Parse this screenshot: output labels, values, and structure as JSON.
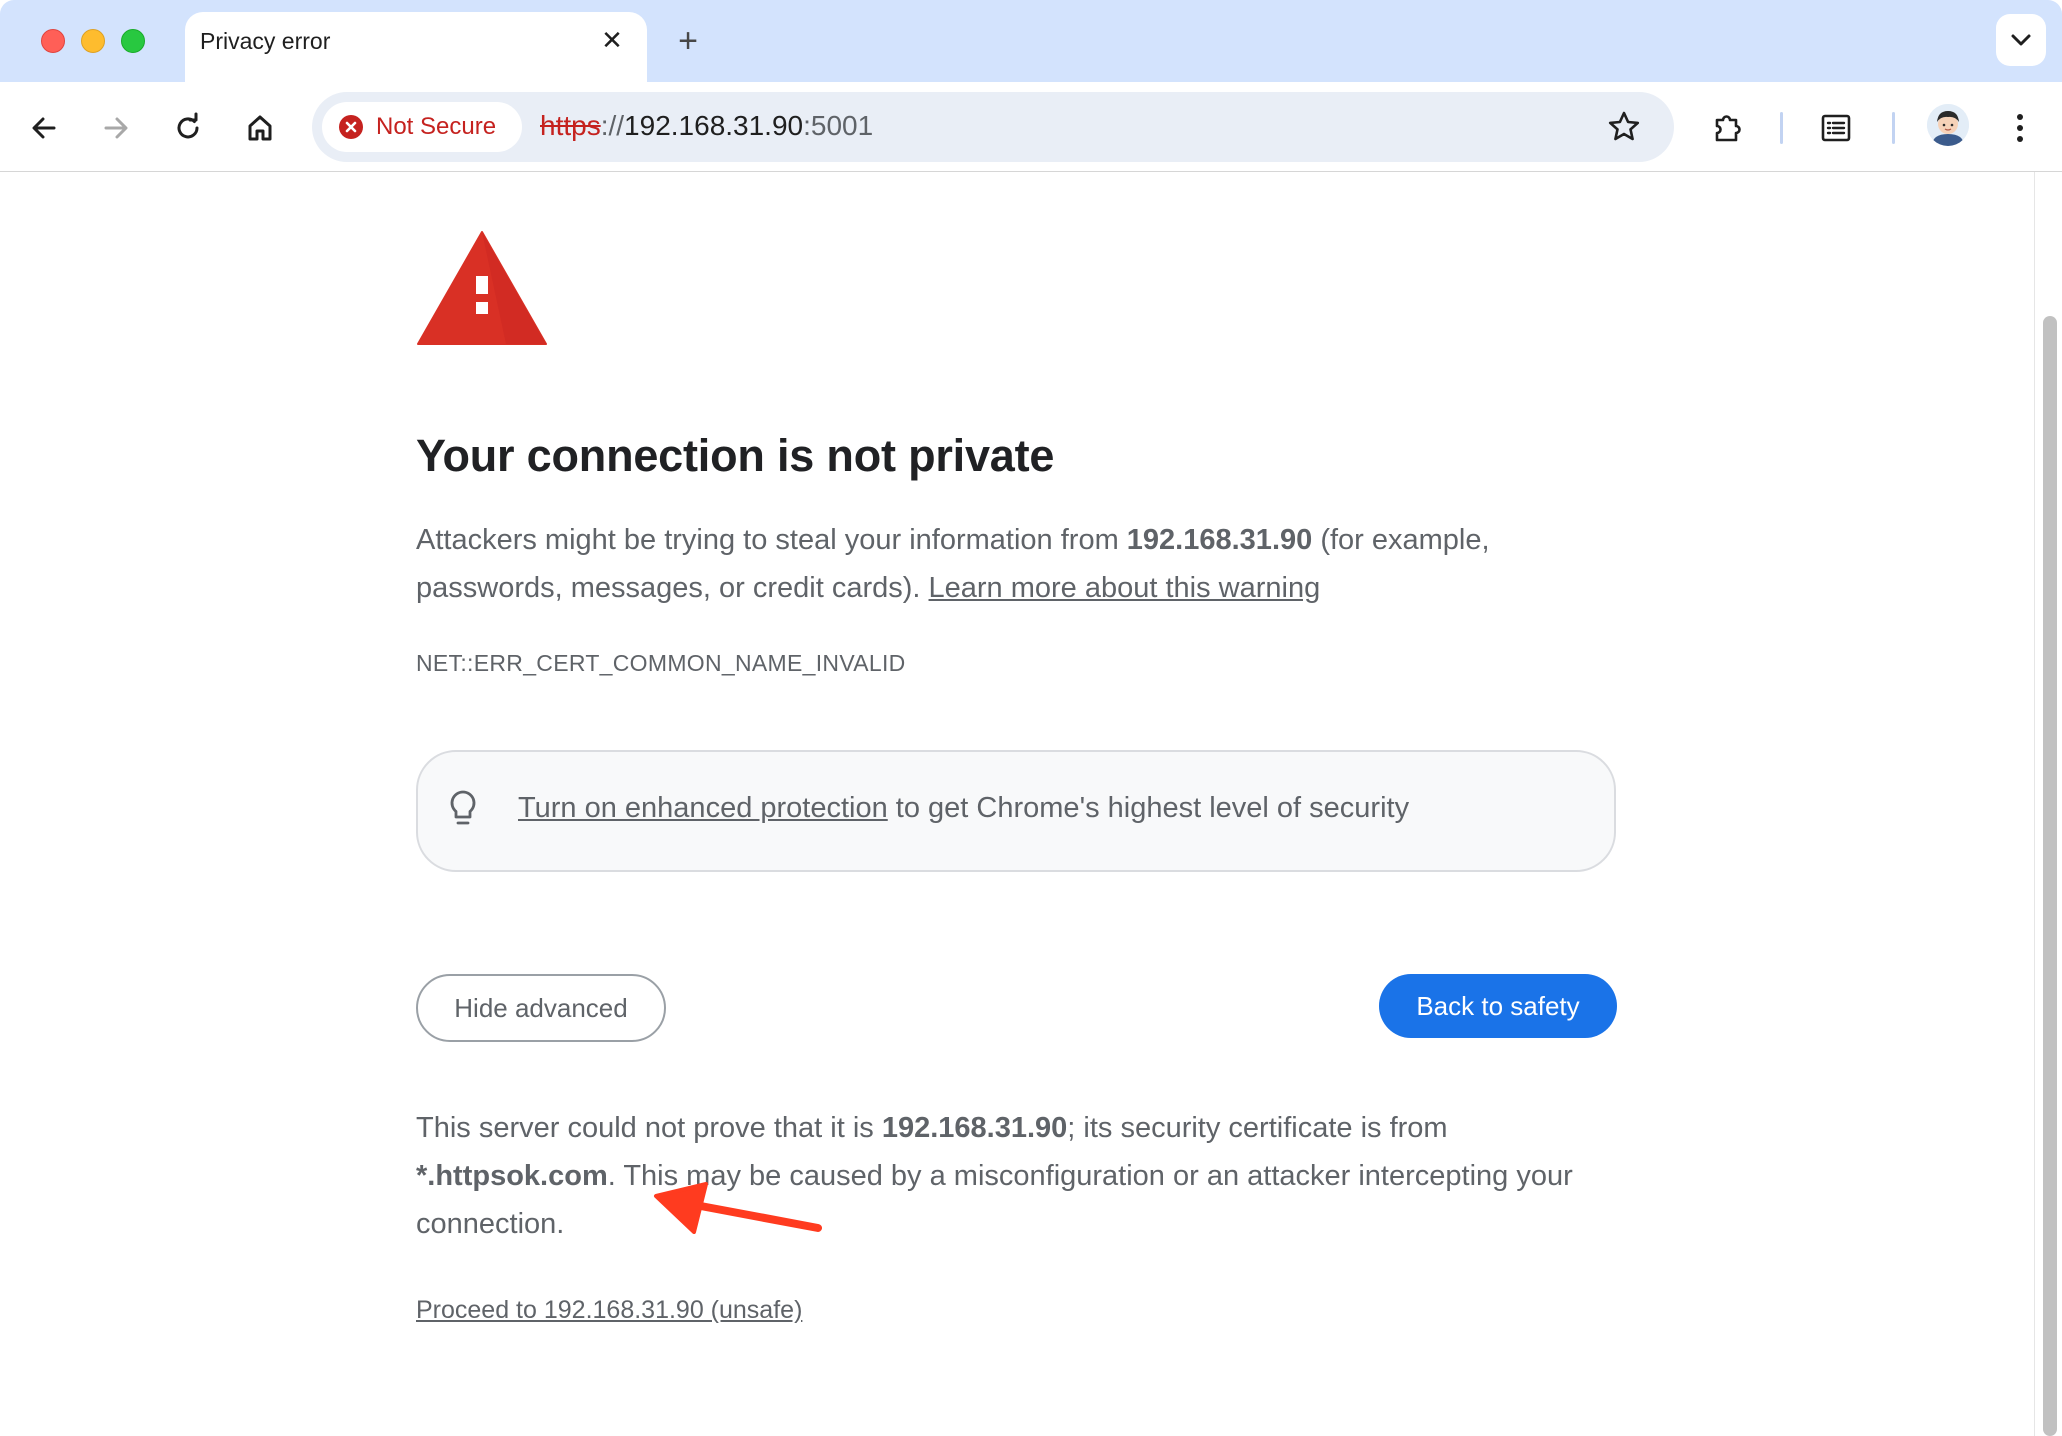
{
  "tab": {
    "title": "Privacy error",
    "close_glyph": "✕",
    "new_tab_glyph": "+"
  },
  "toolbar": {
    "security_chip": "Not Secure",
    "url_scheme": "https",
    "url_slashes": "://",
    "url_host": "192.168.31.90",
    "url_port": ":5001"
  },
  "page": {
    "heading": "Your connection is not private",
    "warning_prefix": "Attackers might be trying to steal your information from ",
    "warning_host": "192.168.31.90",
    "warning_suffix": " (for example, passwords, messages, or credit cards). ",
    "learn_more": "Learn more about this warning",
    "error_code": "NET::ERR_CERT_COMMON_NAME_INVALID",
    "enhanced_link": "Turn on enhanced protection",
    "enhanced_rest": " to get Chrome's highest level of security",
    "hide_advanced": "Hide advanced",
    "back_to_safety": "Back to safety",
    "detail_prefix": "This server could not prove that it is ",
    "detail_host": "192.168.31.90",
    "detail_mid": "; its security certificate is from ",
    "detail_cert": "*.httpsok.com",
    "detail_suffix": ". This may be caused by a misconfiguration or an attacker intercepting your connection.",
    "proceed": "Proceed to 192.168.31.90 (unsafe)"
  },
  "colors": {
    "tabstrip": "#d3e3fd",
    "not_secure_red": "#c5221f",
    "primary_blue": "#1a73e8",
    "warning_red": "#d93025",
    "annotation_arrow": "#ff3b1f"
  }
}
